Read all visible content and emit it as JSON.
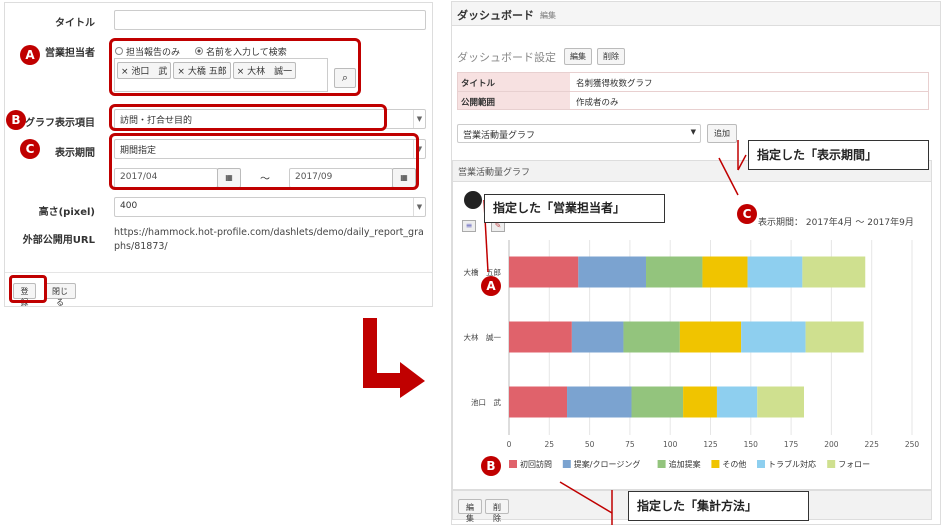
{
  "form": {
    "title_label": "タイトル",
    "sales_rep_label": "営業担当者",
    "radio_report_only": "担当報告のみ",
    "radio_search_by_name": "名前を入力して検索",
    "tags": [
      "池口　武",
      "大橋 五郎",
      "大林　誠一"
    ],
    "graph_item_label": "グラフ表示項目",
    "graph_item_value": "訪問・打合せ目的",
    "period_label": "表示期間",
    "period_value": "期間指定",
    "date_from": "2017/04",
    "date_sep": "～",
    "date_to": "2017/09",
    "height_label": "高さ(pixel)",
    "height_value": "400",
    "public_url_label": "外部公開用URL",
    "public_url_value": "https://hammock.hot-profile.com/dashlets/demo/daily_report_graphs/81873/",
    "register_button": "登録",
    "close_button": "閉じる"
  },
  "badges": {
    "a": "A",
    "b": "B",
    "c": "C"
  },
  "dashboard": {
    "header_title": "ダッシュボード",
    "header_edit": "編集",
    "settings_label": "ダッシュボード設定",
    "edit_button": "編集",
    "delete_button": "削除",
    "table": [
      {
        "key": "タイトル",
        "value": "名刺獲得枚数グラフ"
      },
      {
        "key": "公開範囲",
        "value": "作成者のみ"
      }
    ],
    "graph_select": "営業活動量グラフ",
    "add_button": "追加",
    "panel_title": "営業活動量グラフ",
    "period_text": "表示期間： 2017年4月 ～ 2017年9月",
    "footer_edit": "編集",
    "footer_delete": "削除"
  },
  "callouts": {
    "period": "指定した「表示期間」",
    "sales_rep": "指定した「営業担当者」",
    "aggregation": "指定した「集計方法」"
  },
  "chart_data": {
    "type": "bar",
    "orientation": "horizontal",
    "stacked": true,
    "categories": [
      "大橋　五郎",
      "大林　誠一",
      "池口　武"
    ],
    "series": [
      {
        "name": "初回訪問",
        "color": "#e0626b",
        "values": [
          43,
          39,
          36
        ]
      },
      {
        "name": "提案/クロージング",
        "color": "#7ba3d0",
        "values": [
          42,
          32,
          40
        ]
      },
      {
        "name": "追加提案",
        "color": "#93c47d",
        "values": [
          35,
          35,
          32
        ]
      },
      {
        "name": "その他",
        "color": "#f0c400",
        "values": [
          28,
          38,
          21
        ]
      },
      {
        "name": "トラブル対応",
        "color": "#8ecfef",
        "values": [
          34,
          40,
          25
        ]
      },
      {
        "name": "フォロー",
        "color": "#cfe08f",
        "values": [
          39,
          36,
          29
        ]
      }
    ],
    "x_ticks": [
      "0",
      "25",
      "50",
      "75",
      "100",
      "125",
      "150",
      "175",
      "200",
      "225",
      "250"
    ],
    "xlim": [
      0,
      250
    ],
    "grid": true,
    "legend": "bottom"
  }
}
